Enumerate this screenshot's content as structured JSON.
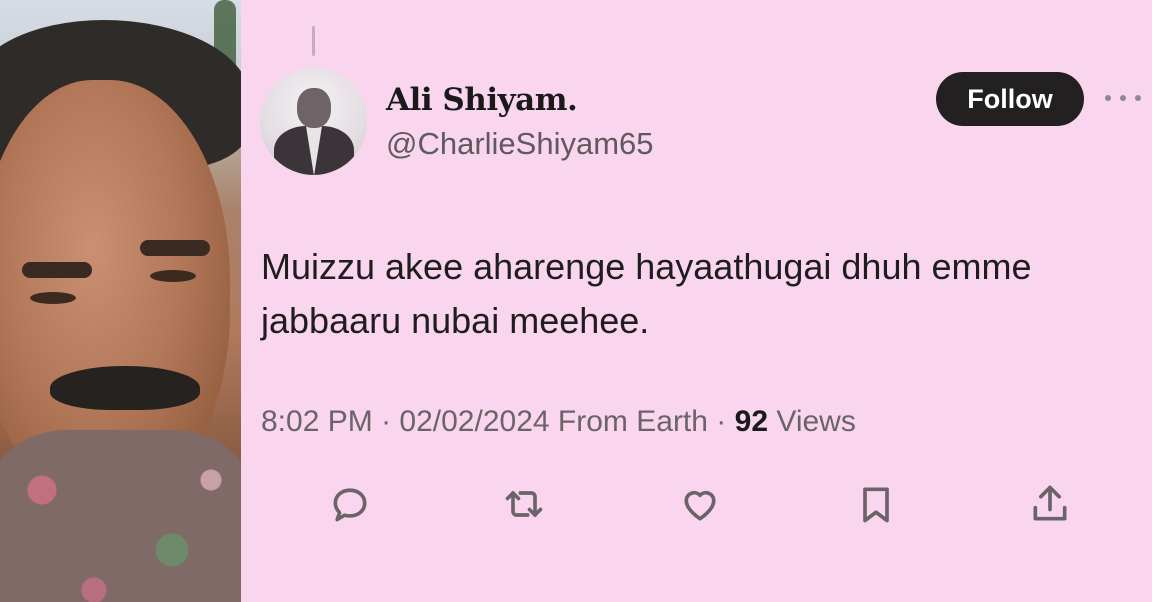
{
  "profile": {
    "display_name": "Ali Shiyam.",
    "handle": "@CharlieShiyam65"
  },
  "follow_label": "Follow",
  "tweet": {
    "line1": "Muizzu akee aharenge hayaathugai dhuh emme",
    "line2": "jabbaaru nubai meehee."
  },
  "meta": {
    "time": "8:02 PM",
    "separator": "·",
    "date": "02/02/2024",
    "source": "From Earth",
    "views_count": "92",
    "views_label": "Views"
  },
  "actions": [
    "reply-icon",
    "retweet-icon",
    "like-icon",
    "bookmark-icon",
    "share-icon"
  ],
  "colors": {
    "background": "#f9d6ee",
    "follow_bg": "#232021",
    "icon": "#6a6468"
  }
}
